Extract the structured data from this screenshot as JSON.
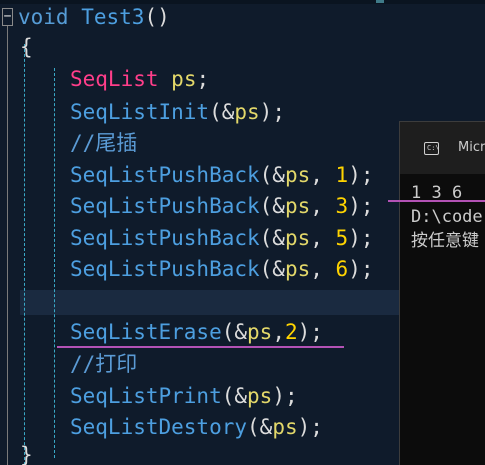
{
  "editor": {
    "fold_symbol": "−",
    "code": {
      "signature": {
        "keyword": "void",
        "name": "Test3",
        "parens": "()"
      },
      "open_brace": "{",
      "close_brace": "}",
      "decl": {
        "type": "SeqList",
        "var": "ps",
        "semi": ";"
      },
      "init": {
        "fn": "SeqListInit",
        "open": "(&",
        "arg": "ps",
        "close": ");"
      },
      "comment_tail_insert": "//尾插",
      "push_backs": [
        {
          "fn": "SeqListPushBack",
          "open": "(&",
          "arg": "ps",
          "sep": ", ",
          "num": "1",
          "close": ");"
        },
        {
          "fn": "SeqListPushBack",
          "open": "(&",
          "arg": "ps",
          "sep": ", ",
          "num": "3",
          "close": ");"
        },
        {
          "fn": "SeqListPushBack",
          "open": "(&",
          "arg": "ps",
          "sep": ", ",
          "num": "5",
          "close": ");"
        },
        {
          "fn": "SeqListPushBack",
          "open": "(&",
          "arg": "ps",
          "sep": ", ",
          "num": "6",
          "close": ");"
        }
      ],
      "erase": {
        "fn": "SeqListErase",
        "open": "(&",
        "arg": "ps",
        "sep": ",",
        "num": "2",
        "close": ");"
      },
      "comment_print": "//打印",
      "print": {
        "fn": "SeqListPrint",
        "open": "(&",
        "arg": "ps",
        "close": ");"
      },
      "destroy": {
        "fn": "SeqListDestory",
        "open": "(&",
        "arg": "ps",
        "close": ");"
      }
    }
  },
  "console": {
    "icon_glyph": "C:\\",
    "title": "Micr",
    "output_lines": [
      "1 3 6",
      "D:\\code",
      "按任意键"
    ]
  },
  "colors": {
    "background": "#0f1b2b",
    "keyword": "#569cd6",
    "function": "#4d9fe0",
    "type": "#ff3e8a",
    "variable": "#e3d86a",
    "number": "#ffd400",
    "comment": "#5b9bd5",
    "annotation_mark": "#b352b5"
  }
}
